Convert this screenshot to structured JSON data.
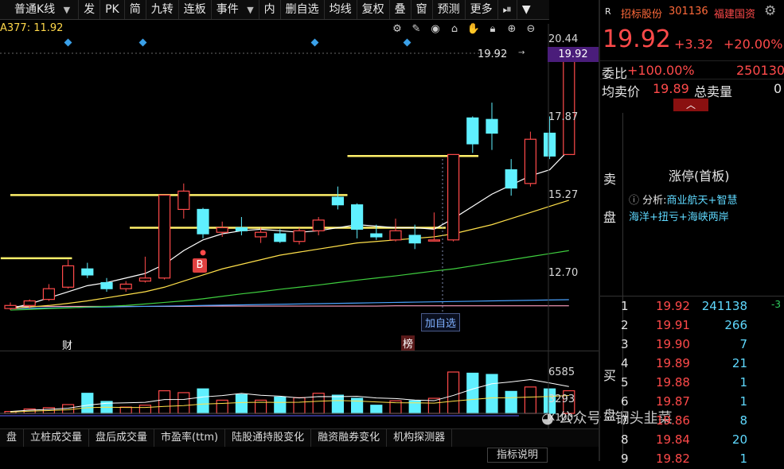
{
  "toolbar": {
    "items": [
      "普通K线",
      "发",
      "PK",
      "简",
      "九转",
      "连板",
      "事件",
      "内",
      "删自选",
      "均线",
      "复权",
      "叠",
      "窗",
      "预测",
      "更多"
    ],
    "dropdown_arrow": "▼",
    "play_icon": "⏯",
    "collapse_icon": "▼"
  },
  "ma_label": "A377: 11.92",
  "y_axis": {
    "upper": [
      "20.44",
      "17.87",
      "15.27",
      "12.70"
    ],
    "volume": [
      "6585",
      "3293"
    ],
    "volume_unit": "X100"
  },
  "price_tag": "19.92",
  "price_hint": "19.92",
  "markers": {
    "b_label": "B",
    "cai": "财",
    "bang": "榜",
    "add_watch": "加自选"
  },
  "bottom_tabs": [
    "盘",
    "立桩成交量",
    "盘后成交量",
    "市盈率(ttm)",
    "陆股通持股变化",
    "融资融券变化",
    "机构探测器"
  ],
  "indicator_button": "指标说明",
  "watermark": "公众号 · 钢头韭菜",
  "quote": {
    "tag": "R",
    "name": "招标股份",
    "code": "301136",
    "region": "福建国资",
    "price": "19.92",
    "change": "+3.32",
    "change_pct": "+20.00%",
    "weibi_label": "委比",
    "weibi": "+100.00%",
    "weibi_vol": "250130",
    "avg_label": "均卖价",
    "avg_price": "19.89",
    "total_sell_label": "总卖量",
    "total_sell": "0"
  },
  "sell_label": [
    "卖",
    "盘"
  ],
  "buy_label": [
    "买",
    "盘"
  ],
  "limit_up": "涨停(首板)",
  "analysis": {
    "prefix": "分析:",
    "line1": "商业航天+智慧",
    "line2": "海洋+扭亏+海峡两岸"
  },
  "bid_levels": [
    {
      "n": "1",
      "p": "19.92",
      "v": "241138",
      "d": "-3"
    },
    {
      "n": "2",
      "p": "19.91",
      "v": "266",
      "d": ""
    },
    {
      "n": "3",
      "p": "19.90",
      "v": "7",
      "d": ""
    },
    {
      "n": "4",
      "p": "19.89",
      "v": "21",
      "d": ""
    },
    {
      "n": "5",
      "p": "19.88",
      "v": "1",
      "d": ""
    },
    {
      "n": "6",
      "p": "19.87",
      "v": "1",
      "d": ""
    },
    {
      "n": "7",
      "p": "19.86",
      "v": "8",
      "d": ""
    },
    {
      "n": "8",
      "p": "19.84",
      "v": "20",
      "d": ""
    },
    {
      "n": "9",
      "p": "19.82",
      "v": "1",
      "d": ""
    }
  ],
  "colors": {
    "up": "#ff4a4a",
    "down": "#5ff0ff",
    "ma5": "#ffffff",
    "ma10": "#ffe04a",
    "ma20": "#3fcf3f",
    "ma60": "#4aa3ff",
    "ma120": "#ff9fc0",
    "support": "#fff06a"
  },
  "chart_data": {
    "type": "candlestick",
    "ylim": [
      11.3,
      20.8
    ],
    "candles": [
      {
        "o": 11.55,
        "h": 11.75,
        "l": 11.5,
        "c": 11.65,
        "up": true,
        "vol": 300
      },
      {
        "o": 11.65,
        "h": 11.85,
        "l": 11.55,
        "c": 11.8,
        "up": true,
        "vol": 700
      },
      {
        "o": 11.85,
        "h": 12.35,
        "l": 11.8,
        "c": 12.2,
        "up": true,
        "vol": 900
      },
      {
        "o": 12.25,
        "h": 13.15,
        "l": 12.2,
        "c": 12.95,
        "up": true,
        "vol": 1400
      },
      {
        "o": 12.85,
        "h": 13.05,
        "l": 12.55,
        "c": 12.65,
        "up": false,
        "vol": 3200
      },
      {
        "o": 12.4,
        "h": 12.55,
        "l": 12.1,
        "c": 12.2,
        "up": false,
        "vol": 1900
      },
      {
        "o": 12.2,
        "h": 12.45,
        "l": 12.1,
        "c": 12.35,
        "up": true,
        "vol": 1000
      },
      {
        "o": 12.45,
        "h": 13.25,
        "l": 12.4,
        "c": 12.55,
        "up": true,
        "vol": 1300
      },
      {
        "o": 12.55,
        "h": 15.27,
        "l": 12.5,
        "c": 15.27,
        "up": true,
        "vol": 3600
      },
      {
        "o": 14.8,
        "h": 15.65,
        "l": 14.5,
        "c": 15.4,
        "up": true,
        "vol": 3300
      },
      {
        "o": 14.8,
        "h": 14.85,
        "l": 13.85,
        "c": 14.0,
        "up": false,
        "vol": 3900
      },
      {
        "o": 14.05,
        "h": 14.4,
        "l": 13.9,
        "c": 14.2,
        "up": true,
        "vol": 2100
      },
      {
        "o": 14.2,
        "h": 14.55,
        "l": 13.95,
        "c": 14.1,
        "up": false,
        "vol": 3000
      },
      {
        "o": 13.9,
        "h": 14.2,
        "l": 13.7,
        "c": 14.05,
        "up": true,
        "vol": 2100
      },
      {
        "o": 14.0,
        "h": 14.15,
        "l": 13.7,
        "c": 13.75,
        "up": false,
        "vol": 2600
      },
      {
        "o": 13.75,
        "h": 14.2,
        "l": 13.65,
        "c": 14.1,
        "up": true,
        "vol": 2500
      },
      {
        "o": 14.1,
        "h": 14.55,
        "l": 13.95,
        "c": 14.45,
        "up": true,
        "vol": 3200
      },
      {
        "o": 15.2,
        "h": 15.55,
        "l": 14.8,
        "c": 14.95,
        "up": false,
        "vol": 2900
      },
      {
        "o": 14.95,
        "h": 15.0,
        "l": 13.85,
        "c": 14.15,
        "up": false,
        "vol": 2400
      },
      {
        "o": 14.0,
        "h": 14.3,
        "l": 13.8,
        "c": 13.9,
        "up": false,
        "vol": 1300
      },
      {
        "o": 13.8,
        "h": 14.5,
        "l": 13.75,
        "c": 14.1,
        "up": true,
        "vol": 2000
      },
      {
        "o": 13.95,
        "h": 14.3,
        "l": 13.5,
        "c": 13.7,
        "up": false,
        "vol": 2000
      },
      {
        "o": 13.8,
        "h": 14.7,
        "l": 13.75,
        "c": 13.8,
        "up": true,
        "vol": 2400
      },
      {
        "o": 13.8,
        "h": 16.6,
        "l": 13.75,
        "c": 16.6,
        "up": true,
        "vol": 6585
      },
      {
        "o": 17.8,
        "h": 17.85,
        "l": 16.65,
        "c": 16.95,
        "up": false,
        "vol": 6400
      },
      {
        "o": 17.75,
        "h": 18.3,
        "l": 16.75,
        "c": 17.3,
        "up": false,
        "vol": 6200
      },
      {
        "o": 16.1,
        "h": 16.45,
        "l": 15.25,
        "c": 15.5,
        "up": false,
        "vol": 3500
      },
      {
        "o": 15.65,
        "h": 17.35,
        "l": 15.55,
        "c": 17.1,
        "up": true,
        "vol": 4200
      },
      {
        "o": 17.3,
        "h": 17.85,
        "l": 16.45,
        "c": 16.55,
        "up": false,
        "vol": 3900
      },
      {
        "o": 16.6,
        "h": 19.92,
        "l": 16.6,
        "c": 19.92,
        "up": true,
        "vol": 3600
      }
    ],
    "ma5": [
      11.55,
      11.7,
      11.9,
      12.1,
      12.3,
      12.4,
      12.55,
      12.7,
      13.0,
      13.45,
      13.8,
      14.0,
      14.1,
      14.15,
      14.1,
      14.05,
      14.1,
      14.2,
      14.3,
      14.25,
      14.2,
      14.2,
      14.15,
      14.5,
      14.9,
      15.3,
      15.6,
      15.9,
      16.1,
      16.75
    ],
    "ma10": [
      11.55,
      11.6,
      11.65,
      11.72,
      11.8,
      11.9,
      12.0,
      12.1,
      12.25,
      12.45,
      12.65,
      12.85,
      13.0,
      13.15,
      13.3,
      13.4,
      13.5,
      13.6,
      13.7,
      13.75,
      13.8,
      13.85,
      13.9,
      14.0,
      14.15,
      14.3,
      14.5,
      14.7,
      14.9,
      15.1
    ],
    "ma20": [
      11.5,
      11.52,
      11.55,
      11.57,
      11.6,
      11.62,
      11.65,
      11.7,
      11.75,
      11.8,
      11.87,
      11.95,
      12.03,
      12.1,
      12.18,
      12.25,
      12.32,
      12.4,
      12.48,
      12.55,
      12.62,
      12.7,
      12.78,
      12.85,
      12.95,
      13.05,
      13.15,
      13.25,
      13.35,
      13.45
    ],
    "ma60": [
      11.55,
      11.56,
      11.57,
      11.58,
      11.59,
      11.6,
      11.61,
      11.62,
      11.63,
      11.64,
      11.65,
      11.66,
      11.67,
      11.68,
      11.69,
      11.7,
      11.71,
      11.72,
      11.73,
      11.74,
      11.75,
      11.76,
      11.77,
      11.78,
      11.79,
      11.8,
      11.81,
      11.82,
      11.83,
      11.84
    ],
    "ma120": [
      11.62,
      11.62,
      11.62,
      11.62,
      11.62,
      11.62,
      11.62,
      11.62,
      11.62,
      11.62,
      11.63,
      11.63,
      11.63,
      11.63,
      11.63,
      11.63,
      11.63,
      11.63,
      11.63,
      11.63,
      11.64,
      11.64,
      11.64,
      11.64,
      11.64,
      11.64,
      11.64,
      11.64,
      11.64,
      11.64
    ],
    "support_lines": [
      {
        "price": 15.27,
        "from": 0,
        "to": 17.5
      },
      {
        "price": 14.2,
        "from": 6.2,
        "to": 22.6
      },
      {
        "price": 13.2,
        "from": -0.5,
        "to": 3.2
      },
      {
        "price": 16.55,
        "from": 17.5,
        "to": 24.3
      }
    ],
    "volume_ylim": [
      0,
      7000
    ]
  }
}
